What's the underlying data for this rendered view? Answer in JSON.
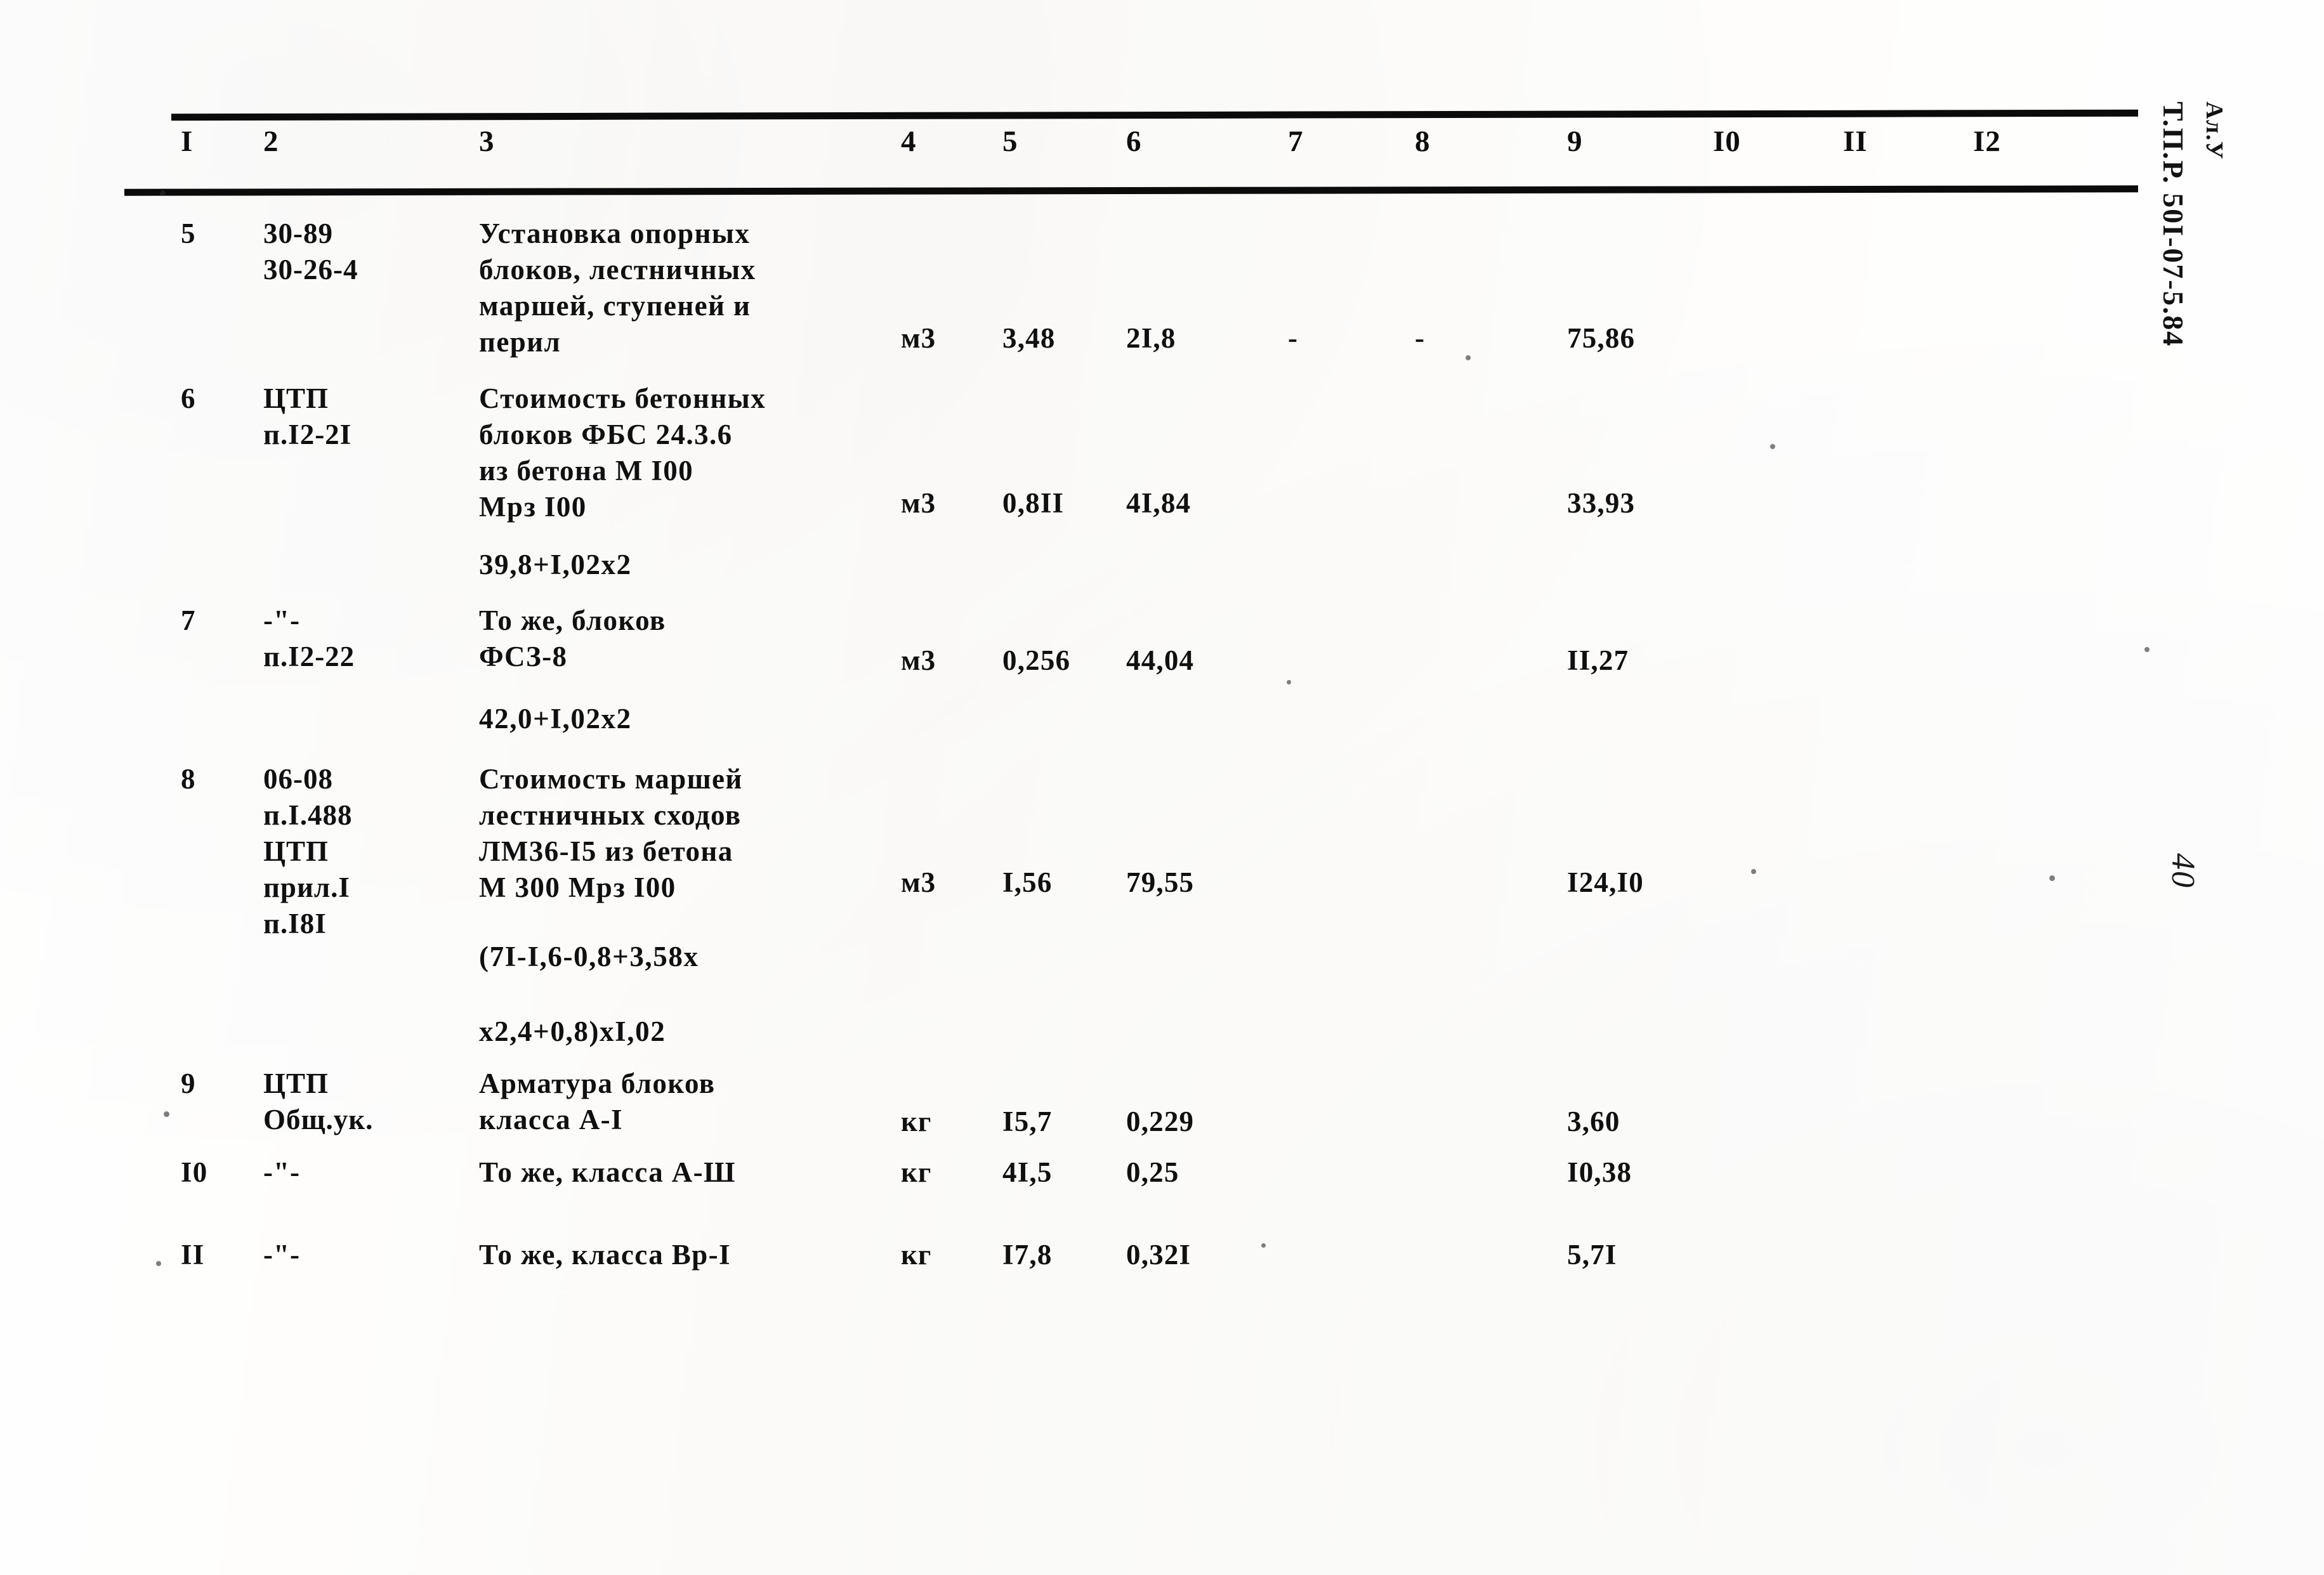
{
  "document": {
    "side_stamp_title": "Т.П.Р. 50I-07-5.84",
    "side_stamp_sub": "Ал.У",
    "page_number": "40"
  },
  "table": {
    "column_headers": [
      "I",
      "2",
      "3",
      "4",
      "5",
      "6",
      "7",
      "8",
      "9",
      "I0",
      "II",
      "I2"
    ],
    "rows": [
      {
        "no": "5",
        "code_lines": [
          "30-89",
          "30-26-4"
        ],
        "desc_lines": [
          "Установка опорных",
          "блоков, лестничных",
          "маршей, ступеней и",
          "перил"
        ],
        "unit": "м3",
        "c5": "3,48",
        "c6": "2I,8",
        "c7": "-",
        "c8": "-",
        "c9": "75,86",
        "formula_lines": []
      },
      {
        "no": "6",
        "code_lines": [
          "ЦТП",
          "п.I2-2I"
        ],
        "desc_lines": [
          "Стоимость бетонных",
          "блоков ФБС 24.3.6",
          "из бетона М I00",
          "Мрз I00"
        ],
        "unit": "м3",
        "c5": "0,8II",
        "c6": "4I,84",
        "c7": "",
        "c8": "",
        "c9": "33,93",
        "formula_lines": [
          "39,8+I,02x2"
        ]
      },
      {
        "no": "7",
        "code_lines": [
          "-\"-",
          "п.I2-22"
        ],
        "desc_lines": [
          "То же, блоков",
          "ФСЗ-8"
        ],
        "unit": "м3",
        "c5": "0,256",
        "c6": "44,04",
        "c7": "",
        "c8": "",
        "c9": "II,27",
        "formula_lines": [
          "42,0+I,02x2"
        ]
      },
      {
        "no": "8",
        "code_lines": [
          "06-08",
          "п.I.488",
          "ЦТП",
          "прил.I",
          "п.I8I"
        ],
        "desc_lines": [
          "Стоимость маршей",
          "лестничных сходов",
          "ЛМ36-I5 из бетона",
          "М 300 Мрз I00"
        ],
        "unit": "м3",
        "c5": "I,56",
        "c6": "79,55",
        "c7": "",
        "c8": "",
        "c9": "I24,I0",
        "formula_lines": [
          "(7I-I,6-0,8+3,58x",
          "x2,4+0,8)xI,02"
        ]
      },
      {
        "no": "9",
        "code_lines": [
          "ЦТП",
          "Общ.ук."
        ],
        "desc_lines": [
          "Арматура блоков",
          "класса А-I"
        ],
        "unit": "кг",
        "c5": "I5,7",
        "c6": "0,229",
        "c7": "",
        "c8": "",
        "c9": "3,60",
        "formula_lines": []
      },
      {
        "no": "I0",
        "code_lines": [
          "-\"-"
        ],
        "desc_lines": [
          "То же, класса А-Ш"
        ],
        "unit": "кг",
        "c5": "4I,5",
        "c6": "0,25",
        "c7": "",
        "c8": "",
        "c9": "I0,38",
        "formula_lines": []
      },
      {
        "no": "II",
        "code_lines": [
          "-\"-"
        ],
        "desc_lines": [
          "То же, класса Вр-I"
        ],
        "unit": "кг",
        "c5": "I7,8",
        "c6": "0,32I",
        "c7": "",
        "c8": "",
        "c9": "5,7I",
        "formula_lines": []
      }
    ]
  }
}
